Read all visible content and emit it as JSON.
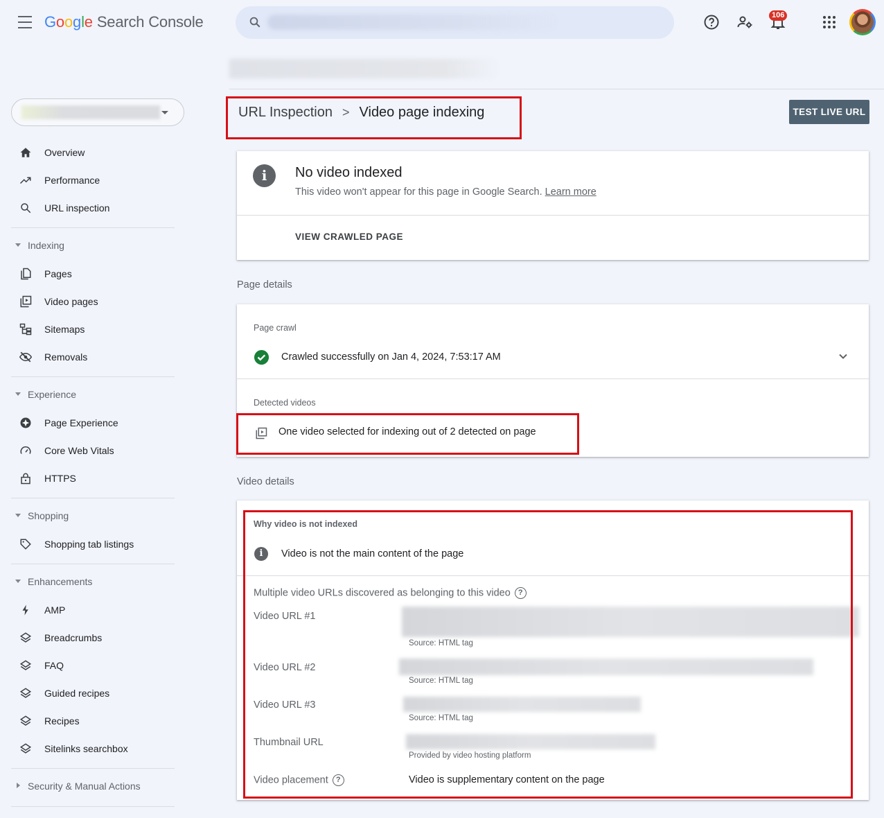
{
  "app": {
    "logo_letters": [
      "G",
      "o",
      "o",
      "g",
      "l",
      "e"
    ],
    "name": "Search Console",
    "notification_count": "106"
  },
  "sidebar": {
    "items_top": [
      {
        "label": "Overview",
        "icon": "home-icon"
      },
      {
        "label": "Performance",
        "icon": "trending-up-icon"
      },
      {
        "label": "URL inspection",
        "icon": "search-icon"
      }
    ],
    "sections": [
      {
        "label": "Indexing",
        "items": [
          {
            "label": "Pages",
            "icon": "pages-icon"
          },
          {
            "label": "Video pages",
            "icon": "video-pages-icon"
          },
          {
            "label": "Sitemaps",
            "icon": "sitemap-icon"
          },
          {
            "label": "Removals",
            "icon": "eye-off-icon"
          }
        ]
      },
      {
        "label": "Experience",
        "items": [
          {
            "label": "Page Experience",
            "icon": "page-experience-icon"
          },
          {
            "label": "Core Web Vitals",
            "icon": "speed-icon"
          },
          {
            "label": "HTTPS",
            "icon": "lock-icon"
          }
        ]
      },
      {
        "label": "Shopping",
        "items": [
          {
            "label": "Shopping tab listings",
            "icon": "tag-icon"
          }
        ]
      },
      {
        "label": "Enhancements",
        "items": [
          {
            "label": "AMP",
            "icon": "bolt-icon"
          },
          {
            "label": "Breadcrumbs",
            "icon": "layers-icon"
          },
          {
            "label": "FAQ",
            "icon": "layers-icon"
          },
          {
            "label": "Guided recipes",
            "icon": "layers-icon"
          },
          {
            "label": "Recipes",
            "icon": "layers-icon"
          },
          {
            "label": "Sitelinks searchbox",
            "icon": "layers-icon"
          }
        ]
      },
      {
        "label": "Security & Manual Actions",
        "collapsed": true
      }
    ]
  },
  "main": {
    "breadcrumb": {
      "parent": "URL Inspection",
      "separator": ">",
      "current": "Video page indexing"
    },
    "test_live_url": "TEST LIVE URL",
    "status": {
      "title": "No video indexed",
      "description": "This video won't appear for this page in Google Search.",
      "learn_more": "Learn more",
      "view_crawled": "VIEW CRAWLED PAGE"
    },
    "page_details": {
      "section_title": "Page details",
      "crawl_head": "Page crawl",
      "crawl_text": "Crawled successfully on Jan 4, 2024, 7:53:17 AM",
      "detected_head": "Detected videos",
      "detected_text": "One video selected for indexing out of 2 detected on page"
    },
    "video_details": {
      "section_title": "Video details",
      "why_head": "Why video is not indexed",
      "reason": "Video is not the main content of the page",
      "multi_urls": "Multiple video URLs discovered as belonging to this video",
      "rows": [
        {
          "label": "Video URL #1",
          "source": "Source: HTML tag"
        },
        {
          "label": "Video URL #2",
          "source": "Source: HTML tag"
        },
        {
          "label": "Video URL #3",
          "source": "Source: HTML tag"
        },
        {
          "label": "Thumbnail URL",
          "source": "Provided by video hosting platform"
        }
      ],
      "placement_label": "Video placement",
      "placement_value": "Video is supplementary content on the page"
    }
  },
  "colors": {
    "highlight_red": "#d70f17",
    "success_green": "#188038",
    "button_dark": "#4f6271"
  }
}
